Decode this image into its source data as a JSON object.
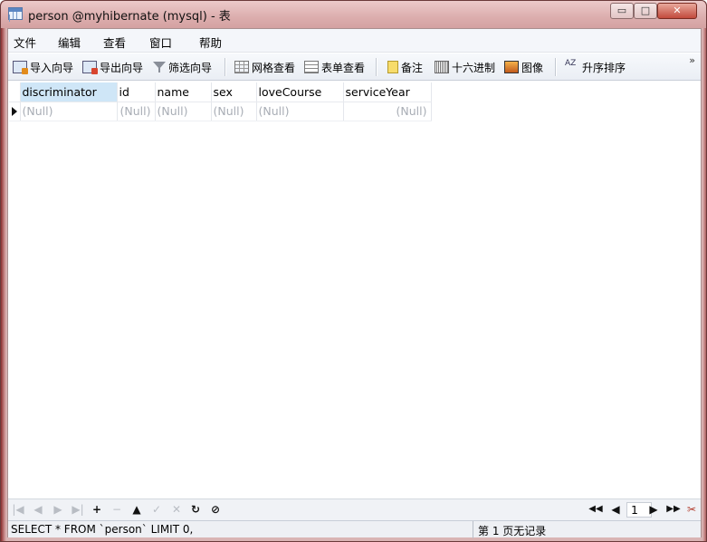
{
  "window": {
    "title": "person @myhibernate (mysql) - 表"
  },
  "titlebar_buttons": {
    "minimize": "▭",
    "maximize": "□",
    "close": "✕"
  },
  "menu": [
    {
      "label": "文件"
    },
    {
      "label": "编辑"
    },
    {
      "label": "查看"
    },
    {
      "label": "窗口"
    },
    {
      "label": "帮助"
    }
  ],
  "toolbar": {
    "import_wizard": {
      "label": "导入向导",
      "icon": "import-wizard-icon"
    },
    "export_wizard": {
      "label": "导出向导",
      "icon": "export-wizard-icon"
    },
    "filter_wizard": {
      "label": "筛选向导",
      "icon": "filter-icon"
    },
    "grid_view": {
      "label": "网格查看",
      "icon": "grid-view-icon"
    },
    "form_view": {
      "label": "表单查看",
      "icon": "form-view-icon"
    },
    "memo": {
      "label": "备注",
      "icon": "memo-icon"
    },
    "hex": {
      "label": "十六进制",
      "icon": "hex-icon"
    },
    "image": {
      "label": "图像",
      "icon": "image-icon"
    },
    "sort_asc": {
      "label": "升序排序",
      "icon": "sort-ascending-icon",
      "glyph": "AZ"
    },
    "overflow": "»"
  },
  "table": {
    "columns": [
      "discriminator",
      "id",
      "name",
      "sex",
      "loveCourse",
      "serviceYear"
    ],
    "selected_column": "discriminator",
    "rows": [
      [
        "(Null)",
        "(Null)",
        "(Null)",
        "(Null)",
        "(Null)",
        "(Null)"
      ]
    ]
  },
  "navigation": {
    "first": "|◀",
    "prev": "◀",
    "next": "▶",
    "last": "▶|",
    "add": "+",
    "delete": "−",
    "apply": "▲",
    "check": "✓",
    "cancel": "✕",
    "refresh": "↻",
    "stop": "⊘",
    "page_first": "◀◀",
    "page_prev": "◀",
    "page_number": "1",
    "page_next": "▶",
    "page_last": "▶▶",
    "settings": "✂"
  },
  "status": {
    "sql": "SELECT * FROM `person` LIMIT 0,",
    "records": "第 1 页无记录"
  }
}
